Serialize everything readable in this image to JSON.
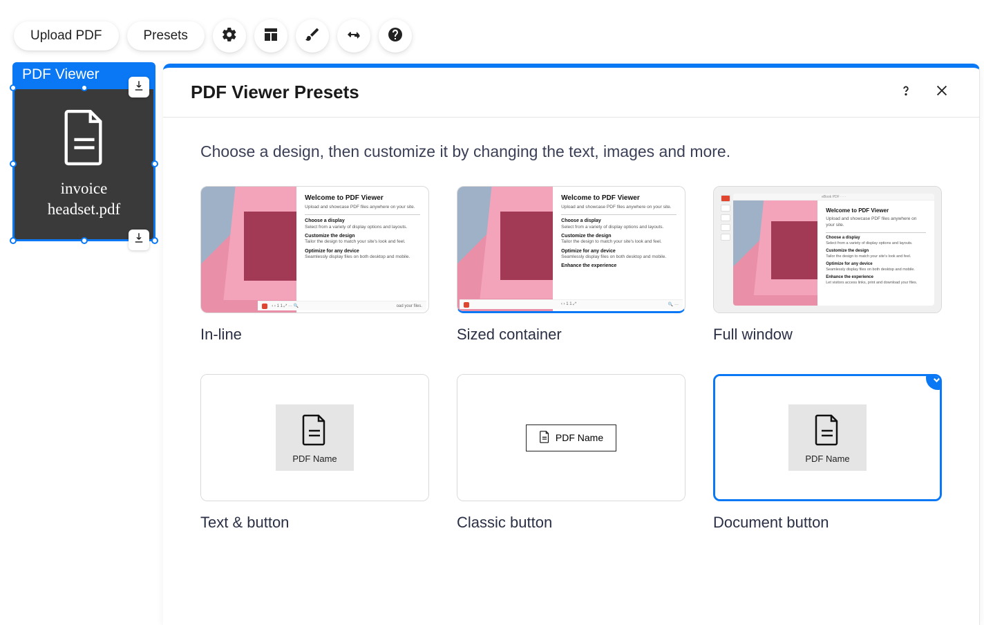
{
  "toolbar": {
    "upload_label": "Upload PDF",
    "presets_label": "Presets"
  },
  "widget": {
    "title": "PDF Viewer",
    "filename_line1": "invoice",
    "filename_line2": "headset.pdf"
  },
  "panel": {
    "title": "PDF Viewer Presets",
    "subtitle": "Choose a design, then customize it by changing the text, images and more."
  },
  "thumb_text": {
    "title": "Welcome to PDF Viewer",
    "sub": "Upload and showcase PDF files anywhere on your site.",
    "h1": "Choose a display",
    "d1": "Select from a variety of display options and layouts.",
    "h2": "Customize the design",
    "d2": "Tailor the design to match your site's look and feel.",
    "h3": "Optimize for any device",
    "d3": "Seamlessly display files on both desktop and mobile.",
    "h4": "Enhance the experience",
    "d4": "Let visitors access links, print and download your files."
  },
  "presets": [
    {
      "label": "In-line"
    },
    {
      "label": "Sized container"
    },
    {
      "label": "Full window"
    },
    {
      "label": "Text & button"
    },
    {
      "label": "Classic button"
    },
    {
      "label": "Document button"
    }
  ],
  "pdf_name_label": "PDF Name"
}
